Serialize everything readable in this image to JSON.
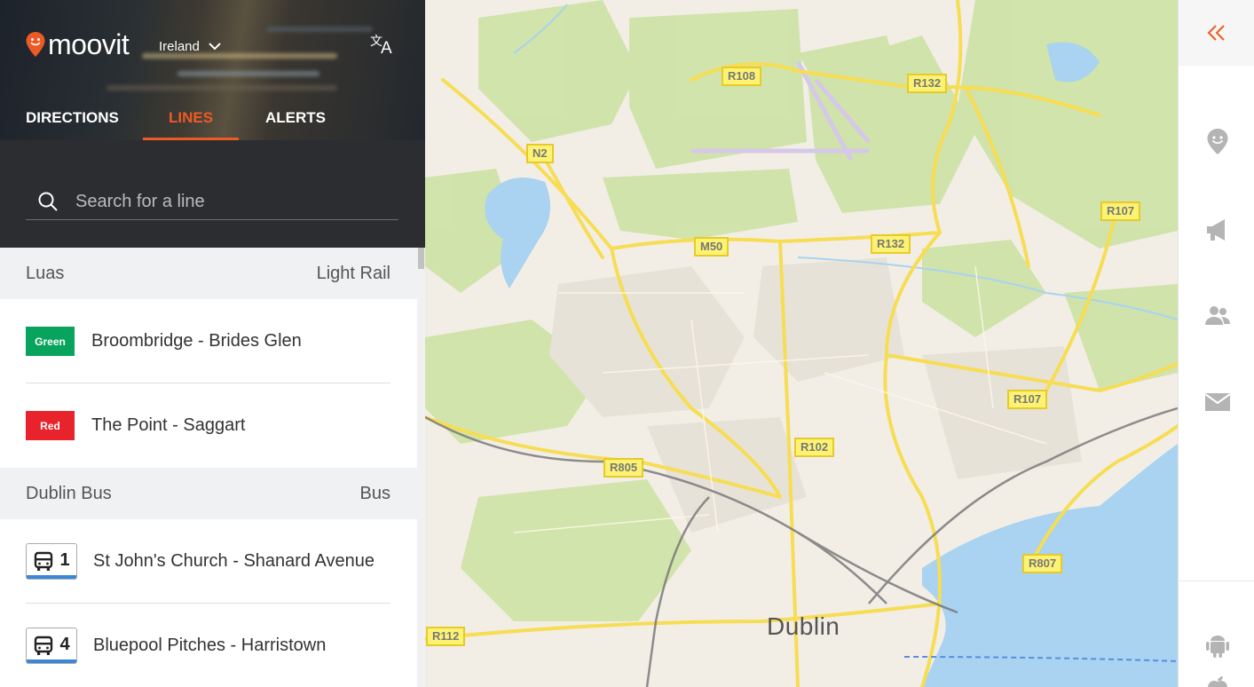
{
  "app": {
    "logo_text": "moovit",
    "region": "Ireland"
  },
  "tabs": [
    {
      "label": "DIRECTIONS",
      "active": false
    },
    {
      "label": "LINES",
      "active": true
    },
    {
      "label": "ALERTS",
      "active": false
    }
  ],
  "search": {
    "placeholder": "Search for a line"
  },
  "categories": [
    {
      "name": "Luas",
      "type": "Light Rail",
      "lines": [
        {
          "badge": "Green",
          "badge_color": "#08a35d",
          "name": "Broombridge - Brides Glen"
        },
        {
          "badge": "Red",
          "badge_color": "#e8232c",
          "name": "The Point - Saggart"
        }
      ]
    },
    {
      "name": "Dublin Bus",
      "type": "Bus",
      "lines": [
        {
          "number": "1",
          "name": "St John's Church - Shanard Avenue"
        },
        {
          "number": "4",
          "name": "Bluepool Pitches - Harristown"
        }
      ]
    }
  ],
  "map": {
    "city": "Dublin",
    "road_labels": [
      "R108",
      "R132",
      "N2",
      "R107",
      "M50",
      "R132",
      "R107",
      "R102",
      "R805",
      "R807",
      "R112"
    ]
  },
  "right_rail": {
    "icons": [
      "collapse-icon",
      "moovit-pin-icon",
      "megaphone-icon",
      "people-icon",
      "mail-icon",
      "android-icon",
      "apple-icon"
    ]
  },
  "colors": {
    "accent": "#ee5a24",
    "bus_underline": "#3a87d6"
  }
}
